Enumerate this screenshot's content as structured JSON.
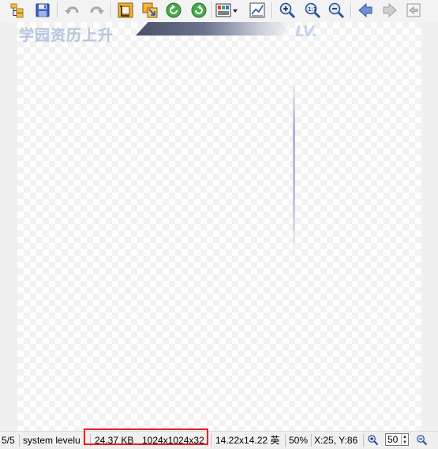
{
  "toolbar": {
    "buttons": [
      {
        "name": "browse-button",
        "icon": "folder-tree-icon"
      },
      {
        "name": "save-button",
        "icon": "floppy-disk-icon"
      },
      {
        "name": "undo-button",
        "icon": "undo-arrow-icon"
      },
      {
        "name": "redo-button",
        "icon": "redo-arrow-icon"
      },
      {
        "name": "crop-button",
        "icon": "crop-icon"
      },
      {
        "name": "resize-button",
        "icon": "resize-icon"
      },
      {
        "name": "rotate-left-button",
        "icon": "rotate-left-icon"
      },
      {
        "name": "rotate-right-button",
        "icon": "rotate-right-icon"
      },
      {
        "name": "color-adjust-button",
        "icon": "palette-icon"
      },
      {
        "name": "histogram-button",
        "icon": "chart-icon"
      },
      {
        "name": "zoom-in-button",
        "icon": "zoom-in-icon"
      },
      {
        "name": "zoom-actual-button",
        "icon": "zoom-1-1-icon"
      },
      {
        "name": "zoom-out-button",
        "icon": "zoom-out-icon"
      },
      {
        "name": "previous-button",
        "icon": "arrow-left-icon"
      },
      {
        "name": "next-button",
        "icon": "arrow-right-icon"
      },
      {
        "name": "exit-button",
        "icon": "exit-icon"
      }
    ]
  },
  "image": {
    "title_text": "学园资历上升",
    "level_text": "LV."
  },
  "status": {
    "index": "5/5",
    "filename": "system levelu",
    "filesize": "24.37 KB",
    "dimensions": "1024x1024x32",
    "print_size": "14.22x14.22 英",
    "zoom_percent": "50%",
    "coords": "X:25, Y:86",
    "zoom_value": "50"
  },
  "colors": {
    "highlight": "#ee1c1c",
    "icon_blue": "#2f5fc4",
    "icon_green": "#3aa142",
    "icon_orange": "#e9a22a"
  }
}
